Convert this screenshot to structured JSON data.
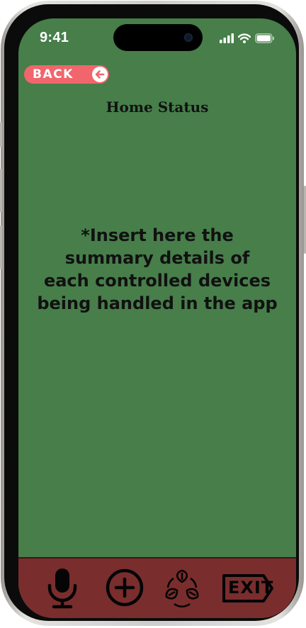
{
  "status_bar": {
    "time": "9:41"
  },
  "header": {
    "back_label": "BACK",
    "title": "Home Status"
  },
  "main": {
    "summary_placeholder": "*Insert here the\nsummary details of\neach controlled devices\nbeing handled in the app"
  },
  "bottom_nav": {
    "items": [
      {
        "icon": "microphone-icon"
      },
      {
        "icon": "plus-circle-icon"
      },
      {
        "icon": "recycle-leaves-icon"
      },
      {
        "icon": "exit-sign-icon",
        "label": "EXIT"
      }
    ]
  },
  "colors": {
    "screen_background": "#477e4a",
    "bottom_bar": "#7a2d2d",
    "back_button": "#f0666c"
  }
}
